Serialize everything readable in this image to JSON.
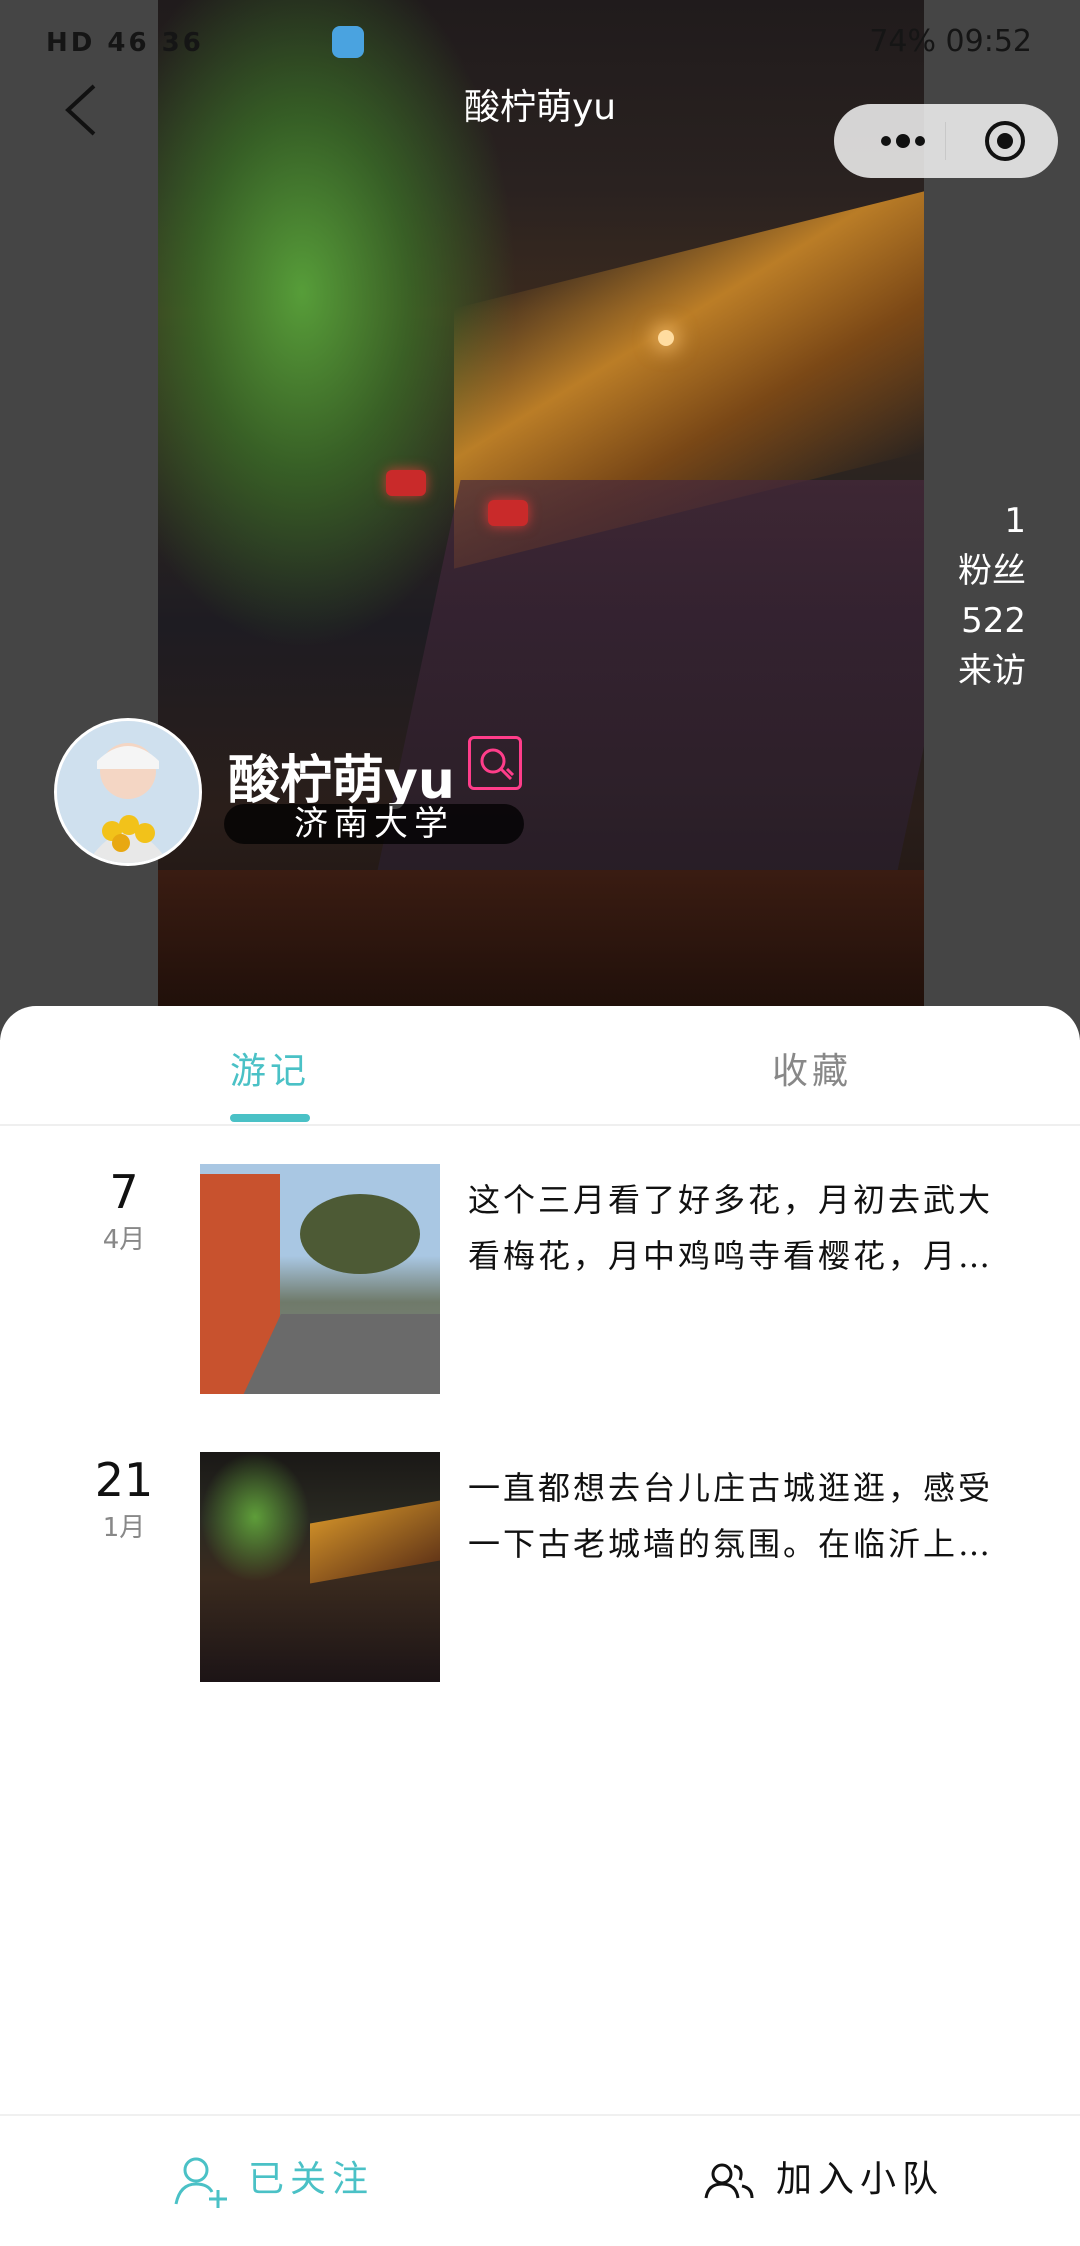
{
  "status_bar": {
    "left": "HD 46 36",
    "right": "74% 09:52"
  },
  "header": {
    "title": "酸柠萌yu"
  },
  "profile": {
    "name": "酸柠萌yu",
    "school": "济南大学",
    "stats": [
      {
        "value": "1",
        "label": "粉丝"
      },
      {
        "value": "522",
        "label": "来访"
      }
    ]
  },
  "tabs": [
    {
      "label": "游记",
      "active": true
    },
    {
      "label": "收藏",
      "active": false
    }
  ],
  "entries": [
    {
      "day": "7",
      "month": "4月",
      "lines": [
        "这个三月看了好多花，月初去武大",
        "看梅花，月中鸡鸣寺看樱花，月…"
      ]
    },
    {
      "day": "21",
      "month": "1月",
      "lines": [
        "一直都想去台儿庄古城逛逛，感受",
        "一下古老城墙的氛围。在临沂上…"
      ]
    }
  ],
  "bottom_bar": {
    "follow_label": "已关注",
    "team_label": "加入小队"
  },
  "colors": {
    "accent": "#4ac1c6",
    "qr": "#ff3d8a"
  },
  "icons": [
    "back-icon",
    "more-icon",
    "target-icon",
    "qr-icon",
    "follow-user-icon",
    "team-icon"
  ]
}
